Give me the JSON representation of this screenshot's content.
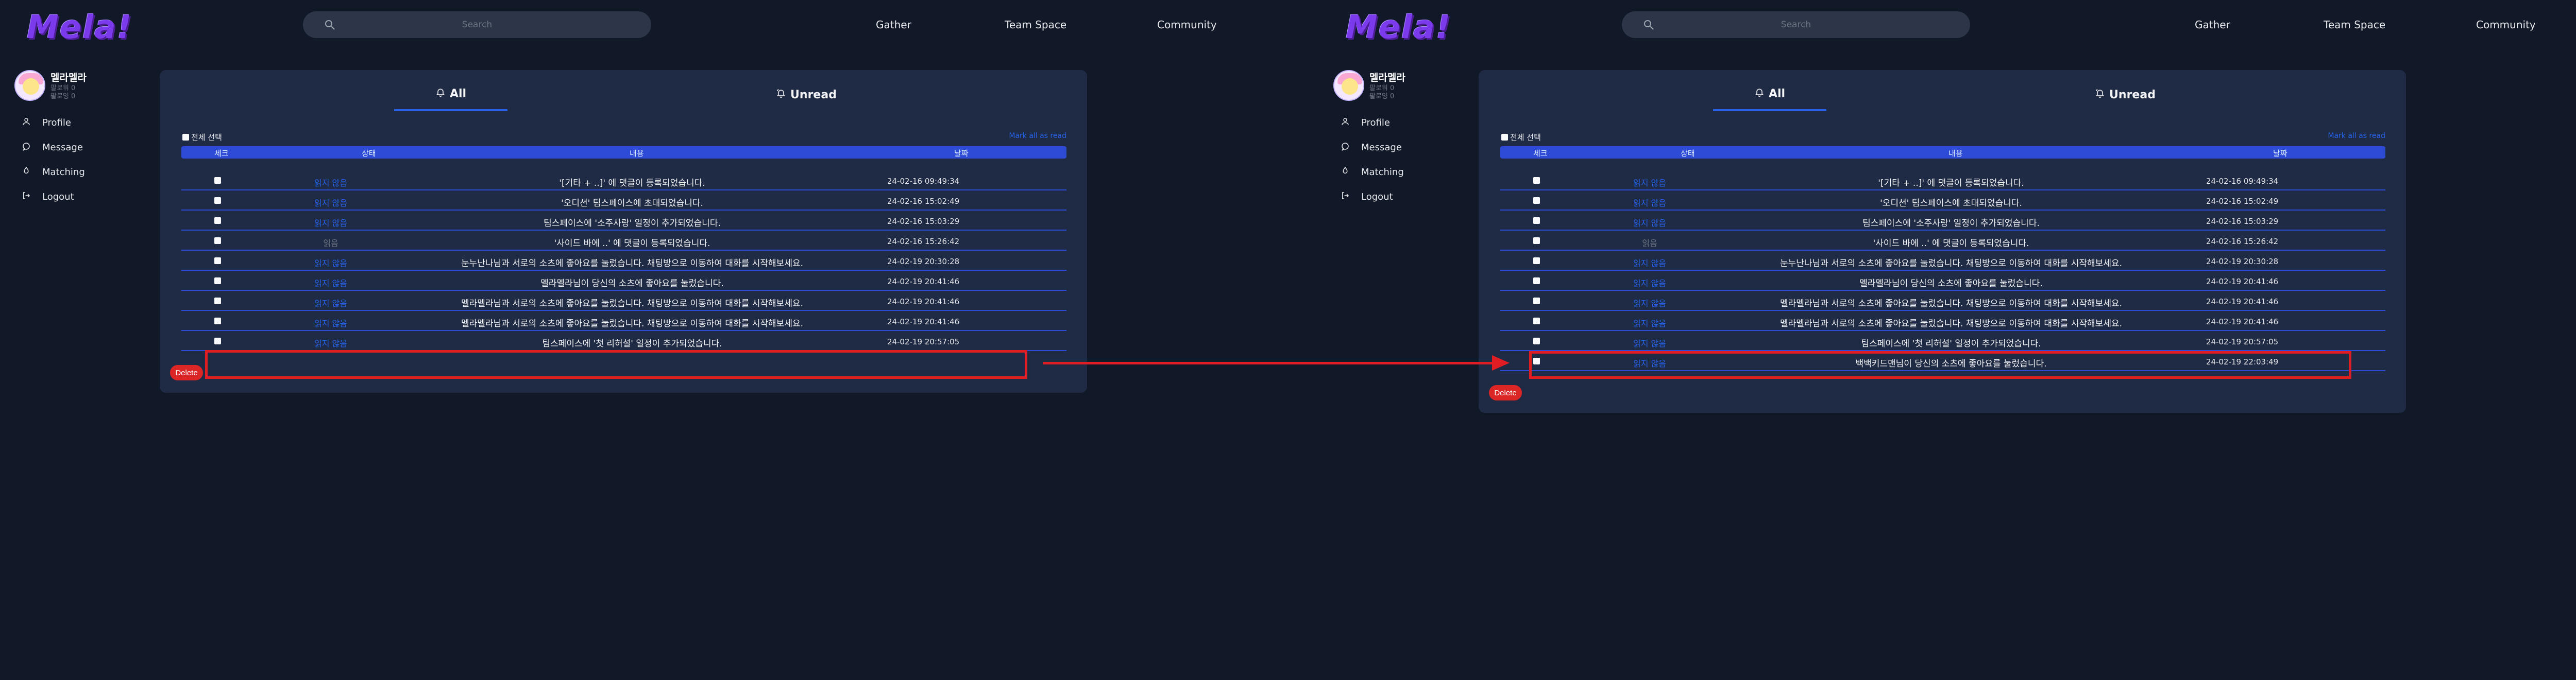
{
  "header": {
    "logo": "Mela!",
    "search_placeholder": "Search",
    "nav": [
      "Gather",
      "Team Space",
      "Community"
    ]
  },
  "sidebar": {
    "user_name": "멜라멜라",
    "stat_1": "팔로워 0",
    "stat_2": "팔로잉 0",
    "items": [
      {
        "label": "Profile",
        "icon": "user-icon"
      },
      {
        "label": "Message",
        "icon": "chat-icon"
      },
      {
        "label": "Matching",
        "icon": "matching-icon"
      },
      {
        "label": "Logout",
        "icon": "logout-icon"
      }
    ]
  },
  "notifications": {
    "tabs": [
      {
        "label": "All",
        "icon": "bell-icon"
      },
      {
        "label": "Unread",
        "icon": "bell-ring-icon"
      }
    ],
    "select_all_label": "전체 선택",
    "mark_all_read": "Mark all as read",
    "columns": [
      "체크",
      "상태",
      "내용",
      "날짜"
    ],
    "delete_label": "Delete",
    "rows_before": [
      {
        "status": "읽지 않음",
        "status_type": "unread",
        "content": "'[기타 + ..]' 에 댓글이 등록되었습니다.",
        "date": "24-02-16 09:49:34"
      },
      {
        "status": "읽지 않음",
        "status_type": "unread",
        "content": "'오디션' 팀스페이스에 초대되었습니다.",
        "date": "24-02-16 15:02:49"
      },
      {
        "status": "읽지 않음",
        "status_type": "unread",
        "content": "팀스페이스에 '소주사랑' 일정이 추가되었습니다.",
        "date": "24-02-16 15:03:29"
      },
      {
        "status": "읽음",
        "status_type": "read",
        "content": "'사이드 바에 ..' 에 댓글이 등록되었습니다.",
        "date": "24-02-16 15:26:42"
      },
      {
        "status": "읽지 않음",
        "status_type": "unread",
        "content": "눈누난나님과 서로의 소츠에 좋아요를 눌렀습니다. 채팅방으로 이동하여 대화를 시작해보세요.",
        "date": "24-02-19 20:30:28"
      },
      {
        "status": "읽지 않음",
        "status_type": "unread",
        "content": "멜라멜라님이 당신의 소츠에 좋아요를 눌렀습니다.",
        "date": "24-02-19 20:41:46"
      },
      {
        "status": "읽지 않음",
        "status_type": "unread",
        "content": "멜라멜라님과 서로의 소츠에 좋아요를 눌렀습니다. 채팅방으로 이동하여 대화를 시작해보세요.",
        "date": "24-02-19 20:41:46"
      },
      {
        "status": "읽지 않음",
        "status_type": "unread",
        "content": "멜라멜라님과 서로의 소츠에 좋아요를 눌렀습니다. 채팅방으로 이동하여 대화를 시작해보세요.",
        "date": "24-02-19 20:41:46"
      },
      {
        "status": "읽지 않음",
        "status_type": "unread",
        "content": "팀스페이스에 '첫 리허설' 일정이 추가되었습니다.",
        "date": "24-02-19 20:57:05"
      }
    ],
    "new_row": {
      "status": "읽지 않음",
      "status_type": "unread",
      "content": "백백키드맨님이 당신의 소츠에 좋아요를 눌렀습니다.",
      "date": "24-02-19 22:03:49"
    }
  },
  "colors": {
    "background": "#111827",
    "card": "#1f2a44",
    "accent": "#2563eb",
    "highlight": "#e11d24",
    "delete": "#dc2626"
  }
}
